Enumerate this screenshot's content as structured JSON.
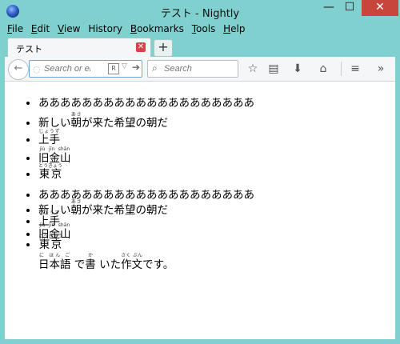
{
  "window": {
    "title": "テスト - Nightly",
    "min": "—",
    "max": "☐",
    "close": "✕"
  },
  "menus": [
    {
      "label": "File",
      "underline": "F",
      "rest": "ile"
    },
    {
      "label": "Edit",
      "underline": "E",
      "rest": "dit"
    },
    {
      "label": "View",
      "underline": "V",
      "rest": "iew"
    },
    {
      "label": "History",
      "underline": "",
      "rest": "History"
    },
    {
      "label": "Bookmarks",
      "underline": "B",
      "rest": "ookmarks"
    },
    {
      "label": "Tools",
      "underline": "T",
      "rest": "ools"
    },
    {
      "label": "Help",
      "underline": "H",
      "rest": "elp"
    }
  ],
  "tab": {
    "label": "テスト",
    "close": "✕"
  },
  "newtab": "+",
  "nav": {
    "back": "←",
    "url_placeholder": "Search or ente",
    "search_placeholder": "Search",
    "go": "➔",
    "reader": "R",
    "drop": "▽"
  },
  "icons": {
    "search": "⌕",
    "star": "☆",
    "clipboard": "▤",
    "download": "⬇",
    "home": "⌂",
    "menu": "≡",
    "more": "»",
    "globe": "◌"
  },
  "content": {
    "list1": {
      "line1": "ああああああああああああああああああああ",
      "line2_pre": "新しい",
      "line2_ruby_base": "朝",
      "line2_ruby_rt": "あさ",
      "line2_post": "が来た希望の朝だ",
      "line3_base": "上手",
      "line3_rt": "じょうず",
      "line4_base": "旧金山",
      "line4_rt": "jiù jīn shān",
      "line5_base": "東京",
      "line5_rt": "とうきょう"
    },
    "list2": {
      "line1": "ああああああああああああああああああああ",
      "line2_pre": "新しい",
      "line2_ruby_base": "朝",
      "line2_ruby_rt": "あさ",
      "line2_post": "が来た希望の朝だ",
      "line3_base": "上手",
      "line3_rt": "じょうず",
      "line4_base": "旧金山",
      "line4_rt": "jiù jīn shān",
      "line5_base": "東京",
      "line5_rt": "とうきょう"
    },
    "final": {
      "w1_base": "日本語",
      "w1_rt": "に ほん ご",
      "w2": "で",
      "w3_base": "書",
      "w3_rt": "か",
      "w4": "いた",
      "w5_base": "作文",
      "w5_rt": "さく ぶん",
      "w6": "です。"
    }
  }
}
